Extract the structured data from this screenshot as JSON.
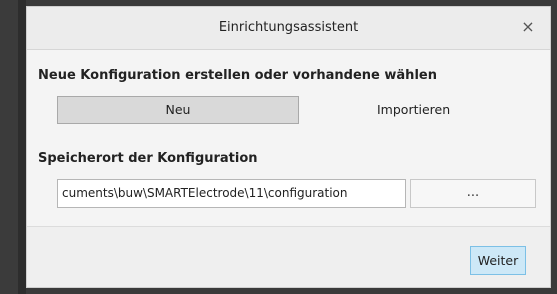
{
  "dialog": {
    "title": "Einrichtungsassistent",
    "close_label": "×"
  },
  "config_section": {
    "label": "Neue Konfiguration erstellen oder vorhandene wählen",
    "new_button": "Neu",
    "import_button": "Importieren"
  },
  "location_section": {
    "label": "Speicherort der Konfiguration",
    "path_value": "cuments\\buw\\SMARTElectrode\\11\\configuration",
    "browse_button": "..."
  },
  "footer": {
    "next_button": "Weiter"
  },
  "colors": {
    "next_button_bg": "#cde8f7",
    "next_button_border": "#7cc0e6"
  },
  "icons": {
    "close": "close-icon"
  }
}
